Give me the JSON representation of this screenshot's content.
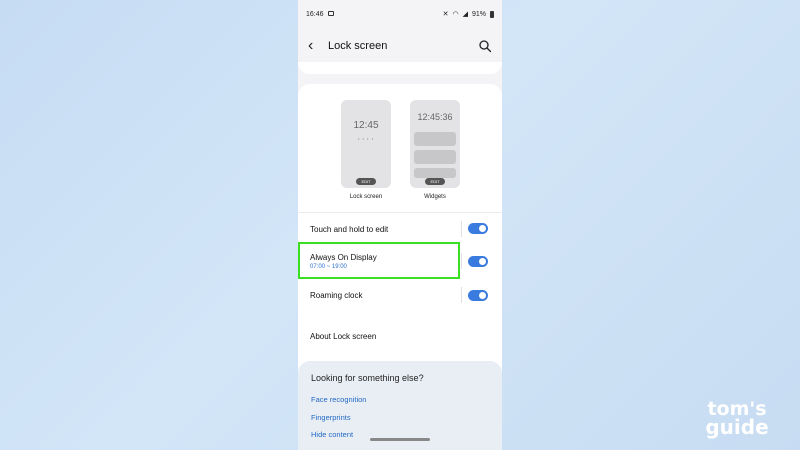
{
  "status_bar": {
    "time": "16:46",
    "icons": [
      "mute-icon",
      "wifi-icon",
      "signal-icon"
    ],
    "battery": "91%"
  },
  "app_bar": {
    "title": "Lock screen",
    "back_icon": "back-arrow-icon",
    "search_icon": "search-icon"
  },
  "previews": {
    "lock_screen": {
      "clock": "12:45",
      "dots": "• • • •",
      "edit": "EDIT",
      "label": "Lock screen"
    },
    "widgets": {
      "clock": "12:45:36",
      "edit": "EDIT",
      "label": "Widgets"
    }
  },
  "settings": [
    {
      "label": "Touch and hold to edit",
      "enabled": true
    },
    {
      "label": "Always On Display",
      "sublabel": "07:00 ~ 19:00",
      "enabled": true
    },
    {
      "label": "Roaming clock",
      "enabled": true
    }
  ],
  "about": {
    "label": "About Lock screen"
  },
  "suggestions": {
    "title": "Looking for something else?",
    "links": [
      "Face recognition",
      "Fingerprints",
      "Hide content"
    ]
  },
  "watermark": {
    "line1": "tom's",
    "line2": "guide"
  },
  "colors": {
    "accent": "#3a7be0",
    "link": "#2369c4",
    "highlight": "#39e022",
    "background": "#c6dcf3"
  }
}
